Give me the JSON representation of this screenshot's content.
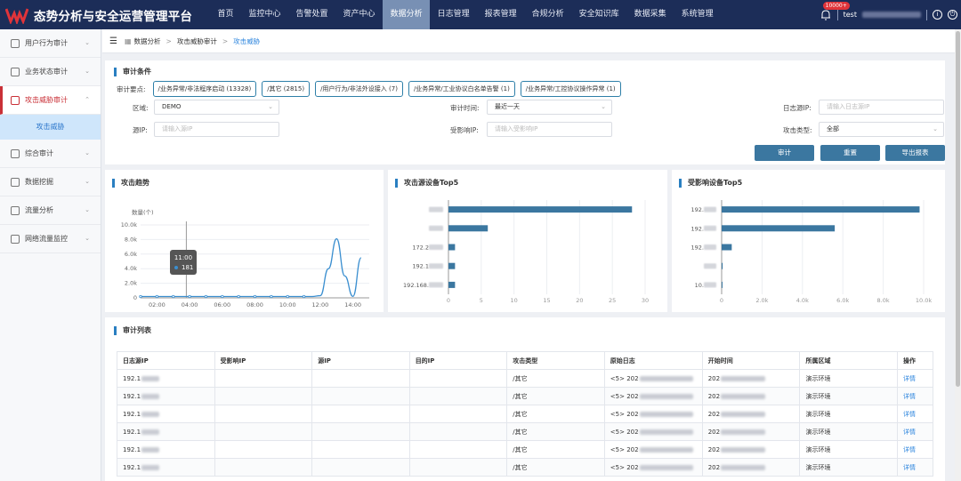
{
  "app": {
    "title": "态势分析与安全运营管理平台"
  },
  "nav": [
    "首页",
    "监控中心",
    "告警处置",
    "资产中心",
    "数据分析",
    "日志管理",
    "报表管理",
    "合规分析",
    "安全知识库",
    "数据采集",
    "系统管理"
  ],
  "header": {
    "badge": "10000+",
    "user": "test"
  },
  "sidebar": {
    "items": [
      {
        "label": "用户行为审计",
        "icon": "user-audit-icon"
      },
      {
        "label": "业务状态审计",
        "icon": "business-audit-icon"
      },
      {
        "label": "攻击威胁审计",
        "icon": "attack-audit-icon"
      },
      {
        "label": "综合审计",
        "icon": "comprehensive-audit-icon"
      },
      {
        "label": "数据挖掘",
        "icon": "data-mining-icon"
      },
      {
        "label": "流量分析",
        "icon": "traffic-icon"
      },
      {
        "label": "网络流量监控",
        "icon": "monitor-icon"
      }
    ],
    "sub_item": "攻击威胁"
  },
  "breadcrumb": [
    "数据分析",
    "攻击威胁审计",
    "攻击威胁"
  ],
  "conditions": {
    "title": "审计条件",
    "key_label": "审计要点:",
    "tags": [
      "/业务异常/非法程序启动 (13328)",
      "/其它 (2815)",
      "/用户行为/非法外设接入 (7)",
      "/业务异常/工业协议白名单告警 (1)",
      "/业务异常/工控协议操作异常 (1)"
    ],
    "region_label": "区域:",
    "region_value": "DEMO",
    "time_label": "审计时间:",
    "time_value": "最近一天",
    "log_ip_label": "日志源IP:",
    "log_ip_placeholder": "请输入日志源IP",
    "src_ip_label": "源IP:",
    "src_ip_placeholder": "请输入源IP",
    "affected_ip_label": "受影响IP:",
    "affected_ip_placeholder": "请输入受影响IP",
    "attack_type_label": "攻击类型:",
    "attack_type_value": "全部",
    "buttons": {
      "audit": "审计",
      "reset": "重置",
      "export": "导出报表"
    }
  },
  "charts_meta": {
    "trend_title": "攻击趋势",
    "src_title": "攻击源设备Top5",
    "affected_title": "受影响设备Top5",
    "tooltip_time": "11:00",
    "tooltip_value": "181"
  },
  "chart_data": [
    {
      "type": "line",
      "title": "攻击趋势",
      "ylabel": "数量(个)",
      "ylim": [
        0,
        10000
      ],
      "yticks": [
        "0",
        "2.0k",
        "4.0k",
        "6.0k",
        "8.0k",
        "10.0k"
      ],
      "xticks": [
        "02:00",
        "04:00",
        "06:00",
        "08:00",
        "10:00",
        "12:00",
        "14:00"
      ],
      "x": [
        1,
        2,
        3,
        4,
        5,
        6,
        7,
        8,
        9,
        10,
        11,
        11.5,
        12,
        12.5,
        13,
        13.5,
        14,
        14.5
      ],
      "values": [
        181,
        181,
        181,
        181,
        181,
        181,
        181,
        181,
        181,
        181,
        181,
        181,
        300,
        4000,
        8100,
        3000,
        200,
        5500
      ]
    },
    {
      "type": "bar",
      "title": "攻击源设备Top5",
      "orientation": "horizontal",
      "categories": [
        "",
        "",
        "172.2",
        "192.1",
        "192.168."
      ],
      "values": [
        28,
        6,
        1,
        1,
        1
      ],
      "xlim": [
        0,
        30
      ],
      "xticks": [
        "0",
        "5",
        "10",
        "15",
        "20",
        "25",
        "30"
      ]
    },
    {
      "type": "bar",
      "title": "受影响设备Top5",
      "orientation": "horizontal",
      "categories": [
        "192.",
        "192.",
        "192.",
        "",
        "10."
      ],
      "values": [
        9800,
        5600,
        500,
        50,
        20
      ],
      "xlim": [
        0,
        10000
      ],
      "xticks": [
        "0",
        "2.0k",
        "4.0k",
        "6.0k",
        "8.0k",
        "10.0k"
      ]
    }
  ],
  "table": {
    "title": "审计列表",
    "columns": [
      "日志源IP",
      "受影响IP",
      "源IP",
      "目的IP",
      "攻击类型",
      "原始日志",
      "开始时间",
      "所属区域",
      "操作"
    ],
    "rows": [
      [
        "192.1",
        "",
        "",
        "",
        "/其它",
        "<5> 202",
        "202",
        "演示环境",
        "详情"
      ],
      [
        "192.1",
        "",
        "",
        "",
        "/其它",
        "<5> 202",
        "202",
        "演示环境",
        "详情"
      ],
      [
        "192.1",
        "",
        "",
        "",
        "/其它",
        "<5> 202",
        "202",
        "演示环境",
        "详情"
      ],
      [
        "192.1",
        "",
        "",
        "",
        "/其它",
        "<5> 202",
        "202",
        "演示环境",
        "详情"
      ],
      [
        "192.1",
        "",
        "",
        "",
        "/其它",
        "<5> 202",
        "202",
        "演示环境",
        "详情"
      ],
      [
        "192.1",
        "",
        "",
        "",
        "/其它",
        "<5> 202",
        "202",
        "演示环境",
        "详情"
      ]
    ]
  },
  "colors": {
    "topbar": "#1c2d58",
    "accent": "#c93037",
    "bar": "#3b77a0",
    "line": "#3b8fd0"
  }
}
